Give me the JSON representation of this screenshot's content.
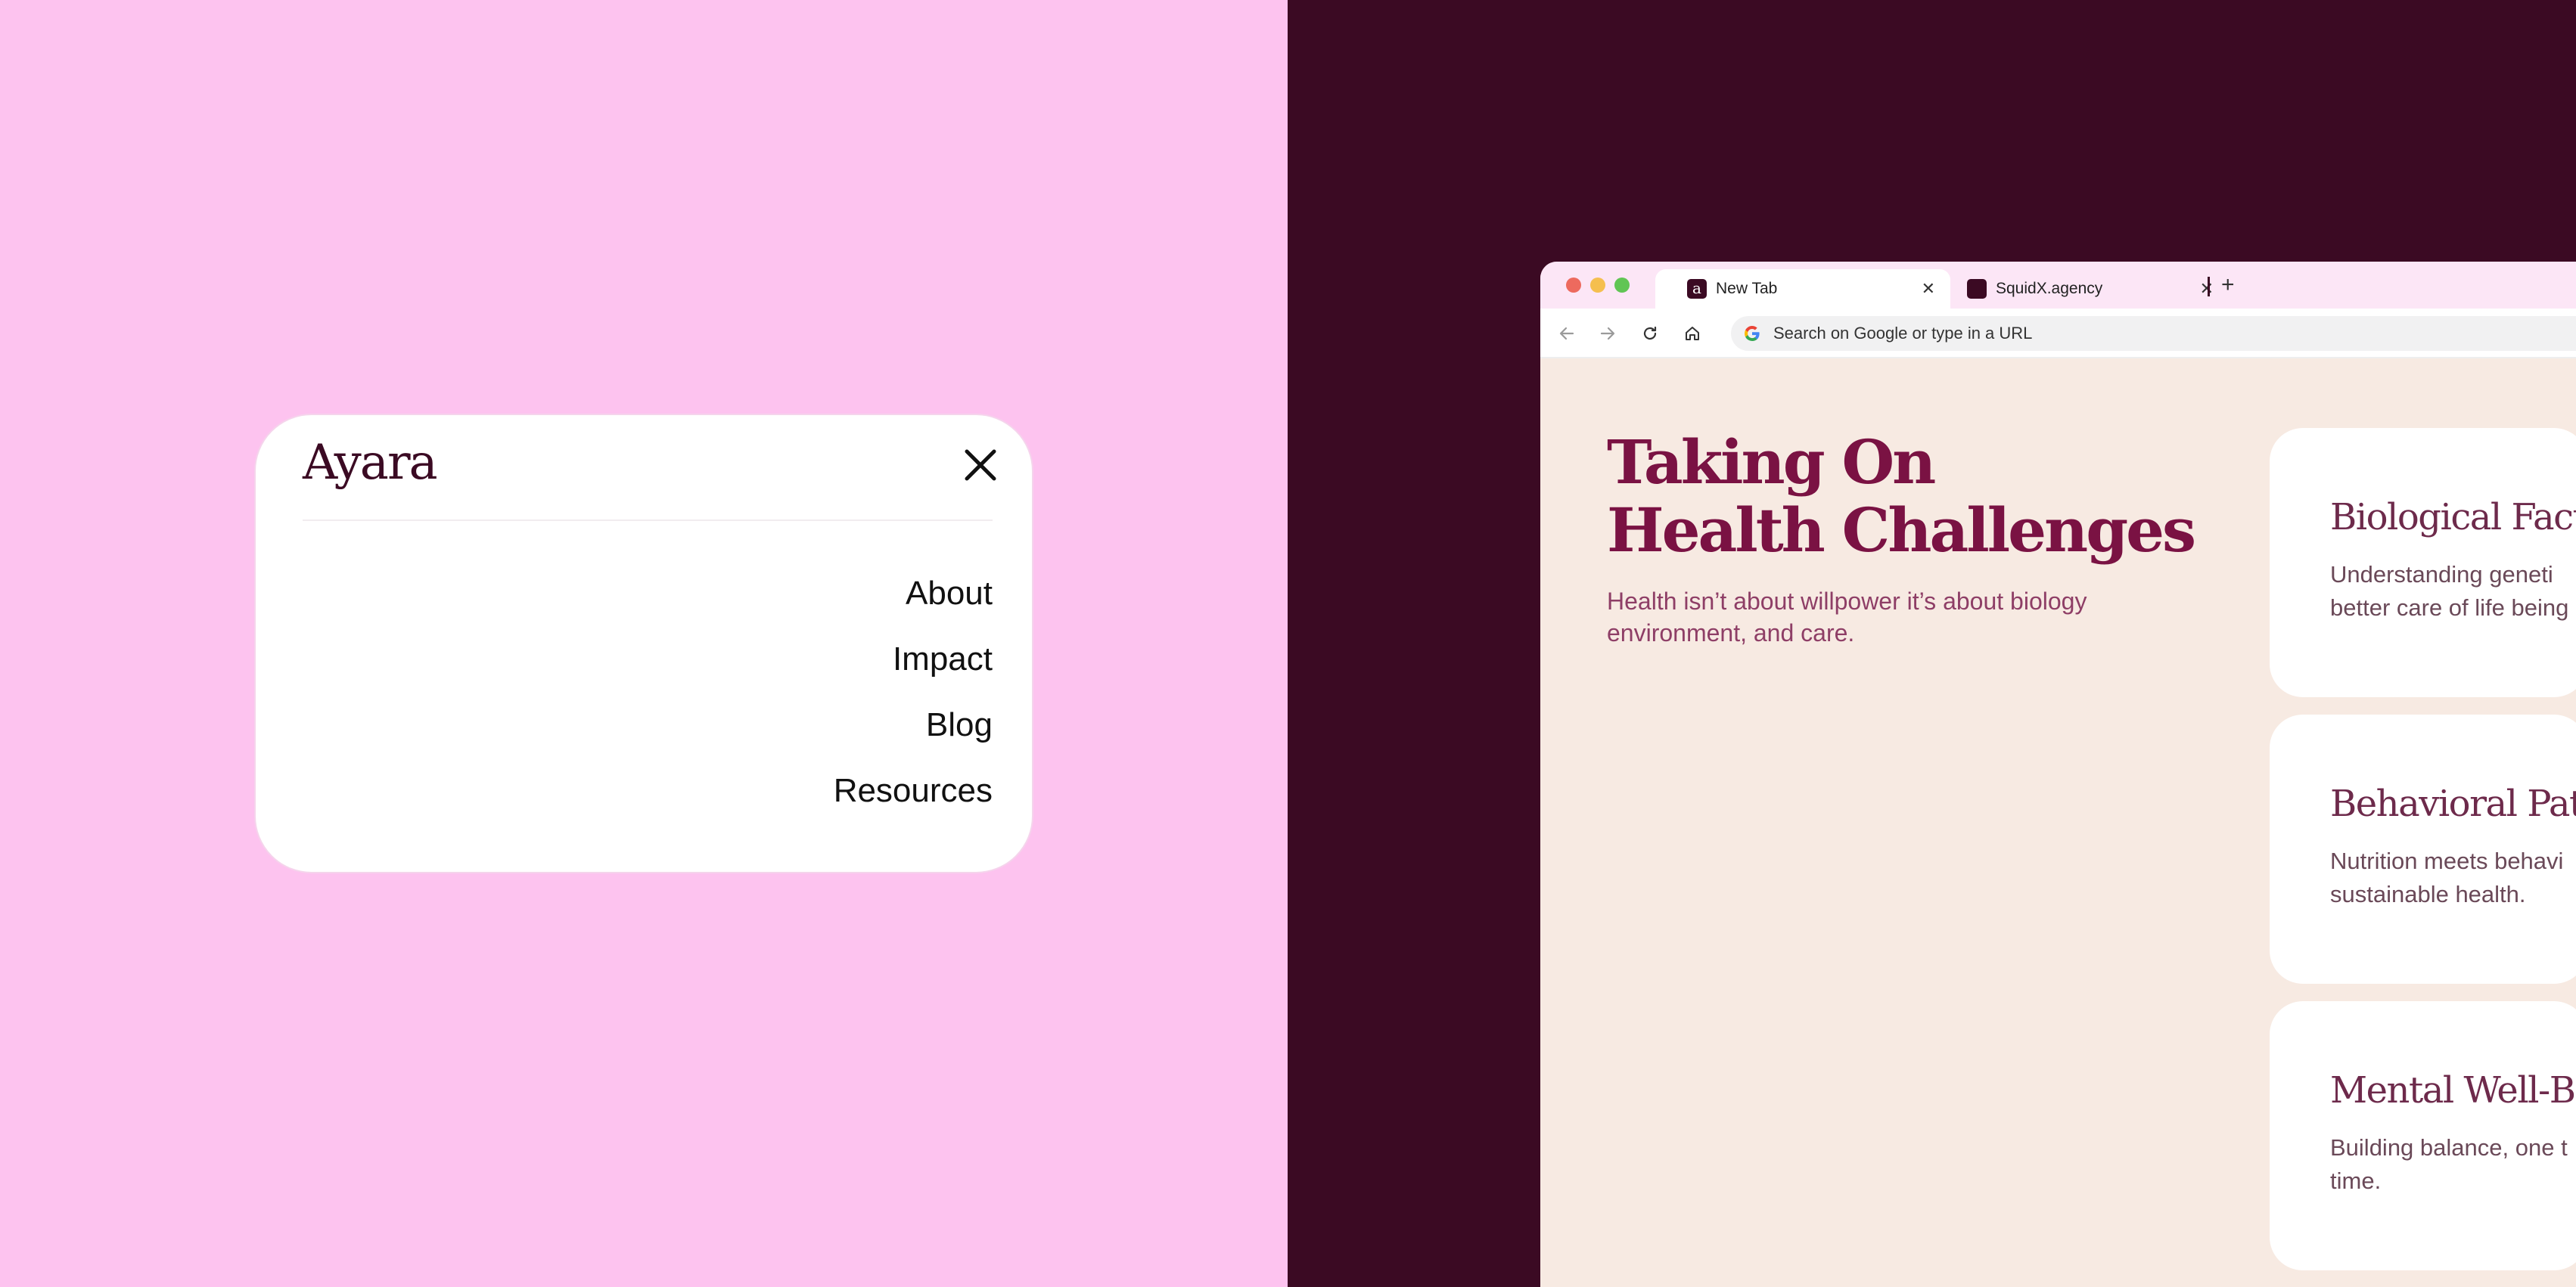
{
  "menu": {
    "logo": "Ayara",
    "items": [
      "About",
      "Impact",
      "Blog",
      "Resources"
    ]
  },
  "browser": {
    "tabs": [
      {
        "label": "New Tab",
        "favicon": "a"
      },
      {
        "label": "SquidX.agency",
        "favicon": ""
      }
    ],
    "address_placeholder": "Search on Google or type in a URL"
  },
  "page": {
    "title_line1": "Taking On",
    "title_line2": "Health Challenges",
    "subtitle": "Health isn’t about willpower it’s about biology environment, and care.",
    "cards": [
      {
        "title": "Biological Facto",
        "line1": "Understanding geneti",
        "line2": "better care of life being"
      },
      {
        "title": "Behavioral Patt",
        "line1": "Nutrition meets behavi",
        "line2": "sustainable health."
      },
      {
        "title": "Mental Well-Be",
        "line1": "Building balance, one t",
        "line2": "time."
      }
    ]
  },
  "colors": {
    "left_bg": "#fdc3ef",
    "right_bg": "#3b0a23",
    "accent": "#7a1243",
    "page_bg": "#f7eae2"
  }
}
